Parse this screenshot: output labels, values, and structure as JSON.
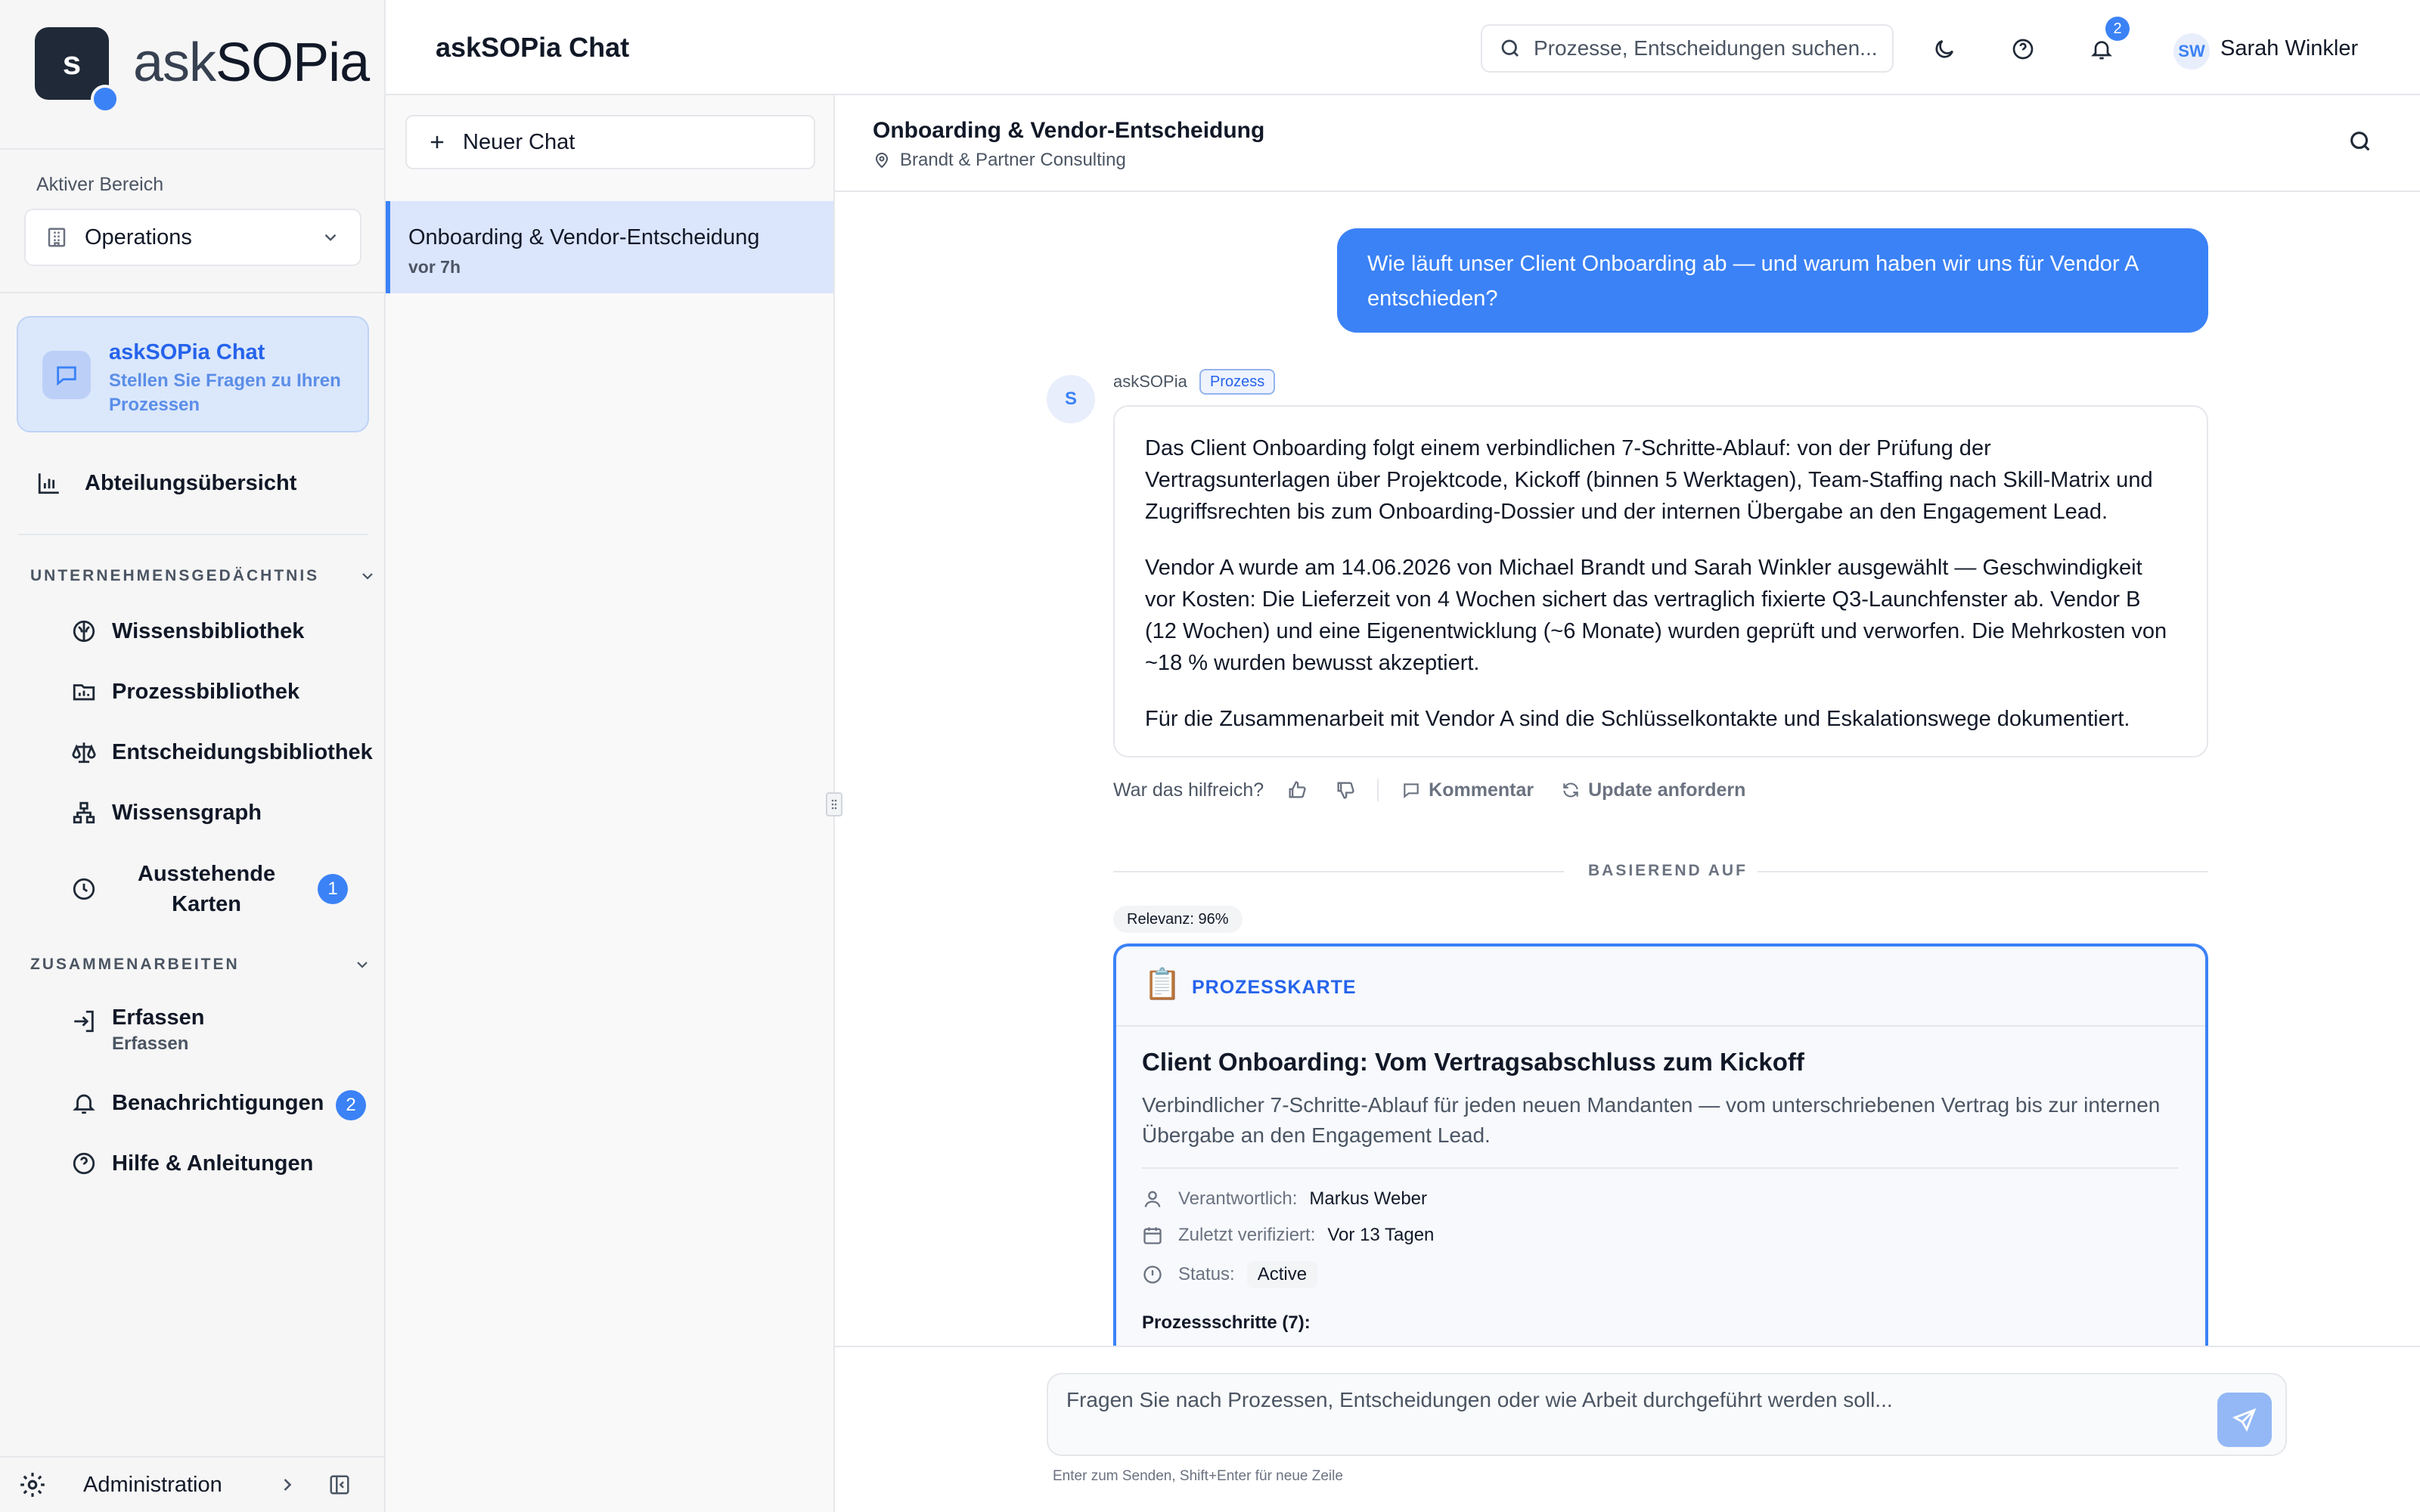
{
  "brand": {
    "logo_letter": "s",
    "name_a": "ask",
    "name_b": "SOPia"
  },
  "sidebar": {
    "area_label": "Aktiver Bereich",
    "area_value": "Operations",
    "chat_card": {
      "title": "askSOPia Chat",
      "subtitle": "Stellen Sie Fragen zu Ihren Prozessen"
    },
    "overview": "Abteilungsübersicht",
    "section_memory": "UNTERNEHMENSGEDÄCHTNIS",
    "memory_items": [
      "Wissensbibliothek",
      "Prozessbibliothek",
      "Entscheidungsbibliothek",
      "Wissensgraph"
    ],
    "pending": {
      "label_line1": "Ausstehende",
      "label_line2": "Karten",
      "count": "1"
    },
    "section_collab": "ZUSAMMENARBEITEN",
    "capture": {
      "label": "Erfassen",
      "sublabel": "Erfassen"
    },
    "notifications": {
      "label": "Benachrichtigungen",
      "count": "2"
    },
    "help": "Hilfe & Anleitungen",
    "admin": "Administration"
  },
  "header": {
    "title": "askSOPia Chat",
    "search_placeholder": "Prozesse, Entscheidungen suchen...",
    "notif_count": "2",
    "user_initials": "SW",
    "user_name": "Sarah Winkler"
  },
  "chatlist": {
    "new_chat": "Neuer Chat",
    "items": [
      {
        "title": "Onboarding & Vendor-Entscheidung",
        "time": "vor 7h"
      }
    ]
  },
  "conversation": {
    "title": "Onboarding & Vendor-Entscheidung",
    "client": "Brandt & Partner Consulting",
    "user_message": "Wie läuft unser Client Onboarding ab — und warum haben wir uns für Vendor A entschieden?",
    "bot_initial": "S",
    "bot_name": "askSOPia",
    "bot_tag": "Prozess",
    "answer": [
      "Das Client Onboarding folgt einem verbindlichen 7-Schritte-Ablauf: von der Prüfung der Vertragsunterlagen über Projektcode, Kickoff (binnen 5 Werktagen), Team-Staffing nach Skill-Matrix und Zugriffsrechten bis zum Onboarding-Dossier und der internen Übergabe an den Engagement Lead.",
      "Vendor A wurde am 14.06.2026 von Michael Brandt und Sarah Winkler ausgewählt — Geschwindigkeit vor Kosten: Die Lieferzeit von 4 Wochen sichert das vertraglich fixierte Q3-Launchfenster ab. Vendor B (12 Wochen) und eine Eigenentwicklung (~6 Monate) wurden geprüft und verworfen. Die Mehrkosten von ~18 % wurden bewusst akzeptiert.",
      "Für die Zusammenarbeit mit Vendor A sind die Schlüsselkontakte und Eskalationswege dokumentiert."
    ],
    "feedback_question": "War das hilfreich?",
    "comment_label": "Kommentar",
    "update_label": "Update anfordern",
    "based_on": "BASIEREND AUF",
    "relevance": "Relevanz: 96%",
    "card": {
      "emoji": "📋",
      "type_label": "PROZESSKARTE",
      "title": "Client Onboarding: Vom Vertragsabschluss zum Kickoff",
      "description": "Verbindlicher 7-Schritte-Ablauf für jeden neuen Mandanten — vom unterschriebenen Vertrag bis zur internen Übergabe an den Engagement Lead.",
      "owner_label": "Verantwortlich:",
      "owner": "Markus Weber",
      "verified_label": "Zuletzt verifiziert:",
      "verified": "Vor 13 Tagen",
      "status_label": "Status:",
      "status": "Active",
      "steps_label": "Prozessschritte (7):"
    }
  },
  "composer": {
    "placeholder": "Fragen Sie nach Prozessen, Entscheidungen oder wie Arbeit durchgeführt werden soll...",
    "hint": "Enter zum Senden, Shift+Enter für neue Zeile"
  },
  "colors": {
    "accent": "#3b82f6",
    "sidebar_bg": "#f6f6f6",
    "active_bg": "#dbe5fb"
  }
}
